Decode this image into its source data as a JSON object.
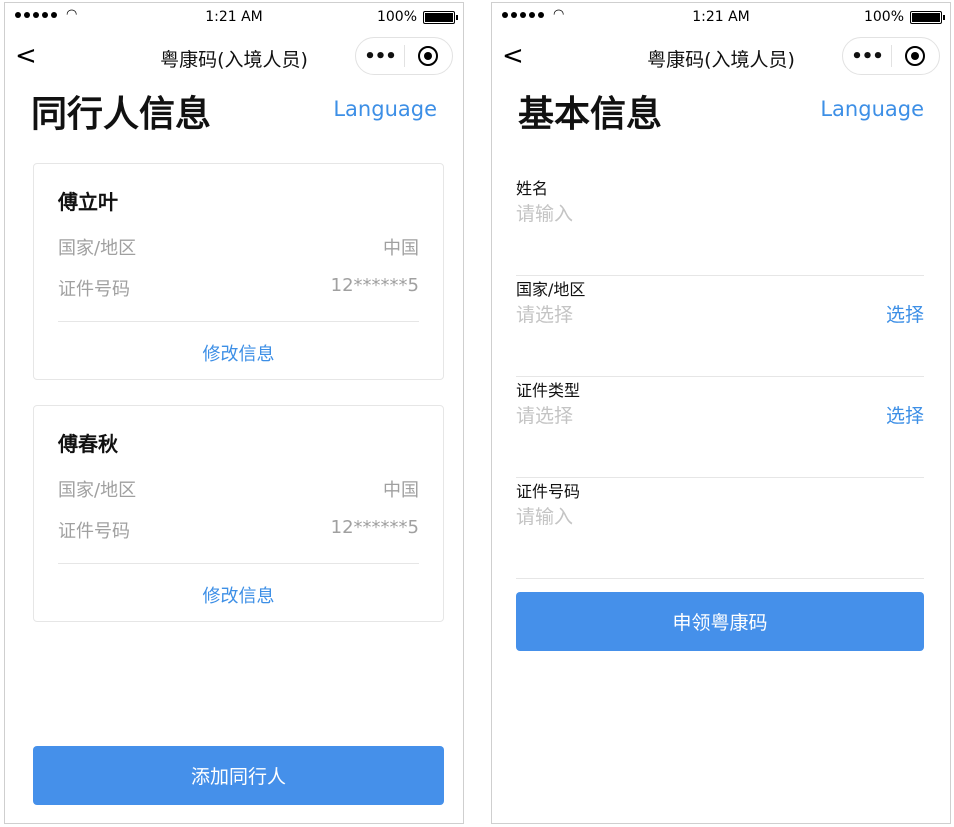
{
  "status": {
    "time": "1:21 AM",
    "battery": "100%"
  },
  "navbar": {
    "title": "粤康码(入境人员)",
    "back": "<",
    "more": "•••"
  },
  "left": {
    "title": "同行人信息",
    "language": "Language",
    "companions": [
      {
        "name": "傅立叶",
        "region_label": "国家/地区",
        "region_value": "中国",
        "id_label": "证件号码",
        "id_value": "12******5",
        "edit": "修改信息"
      },
      {
        "name": "傅春秋",
        "region_label": "国家/地区",
        "region_value": "中国",
        "id_label": "证件号码",
        "id_value": "12******5",
        "edit": "修改信息"
      }
    ],
    "add_button": "添加同行人"
  },
  "right": {
    "title": "基本信息",
    "language": "Language",
    "fields": [
      {
        "label": "姓名",
        "placeholder": "请输入",
        "action": ""
      },
      {
        "label": "国家/地区",
        "placeholder": "请选择",
        "action": "选择"
      },
      {
        "label": "证件类型",
        "placeholder": "请选择",
        "action": "选择"
      },
      {
        "label": "证件号码",
        "placeholder": "请输入",
        "action": ""
      }
    ],
    "submit_button": "申领粤康码"
  },
  "colors": {
    "accent": "#3d8fe6",
    "button": "#4590ea",
    "placeholder": "#c4c4c4"
  }
}
